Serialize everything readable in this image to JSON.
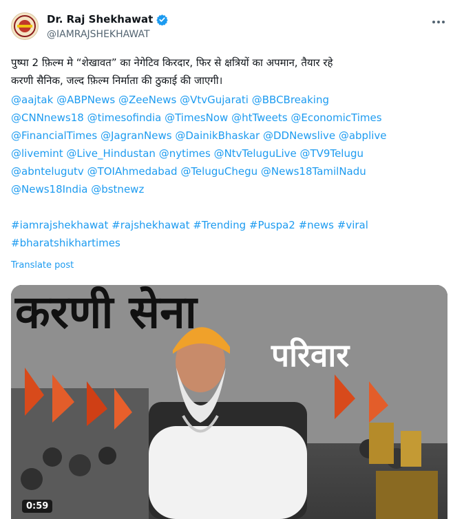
{
  "author": {
    "display_name": "Dr. Raj Shekhawat",
    "handle": "@IAMRAJSHEKHAWAT",
    "verified_icon": "verified-badge-icon",
    "avatar_icon": "avatar-logo"
  },
  "menu_icon": "more-options-icon",
  "post": {
    "body_line1": "पुष्पा 2 फ़िल्म मे “शेखावत” का नेगेटिव किरदार, फिर से क्षत्रियों का अपमान, तैयार रहे",
    "body_line2": "करणी सैनिक, जल्द फ़िल्म निर्माता की ठुकाई की जाएगी।",
    "mentions": [
      "@aajtak",
      "@ABPNews",
      "@ZeeNews",
      "@VtvGujarati",
      "@BBCBreaking",
      "@CNNnews18",
      "@timesofindia",
      "@TimesNow",
      "@htTweets",
      "@EconomicTimes",
      "@FinancialTimes",
      "@JagranNews",
      "@DainikBhaskar",
      "@DDNewslive",
      "@abplive",
      "@livemint",
      "@Live_Hindustan",
      "@nytimes",
      "@NtvTeluguLive",
      "@TV9Telugu",
      "@abntelugutv",
      "@TOIAhmedabad",
      "@TeluguChegu",
      "@News18TamilNadu",
      "@News18India",
      "@bstnewz"
    ],
    "hashtags": [
      "#iamrajshekhawat",
      "#rajshekhawat",
      "#Trending",
      "#Puspa2",
      "#news",
      "#viral",
      "#bharatshikhartimes"
    ],
    "translate_label": "Translate post"
  },
  "video": {
    "timestamp": "0:59",
    "banner_text_top": "करणी सेना",
    "banner_text_mid": "परिवार"
  },
  "colors": {
    "link": "#1d9bf0",
    "text": "#0f1419",
    "secondary": "#536471",
    "turban": "#f0a12a"
  }
}
